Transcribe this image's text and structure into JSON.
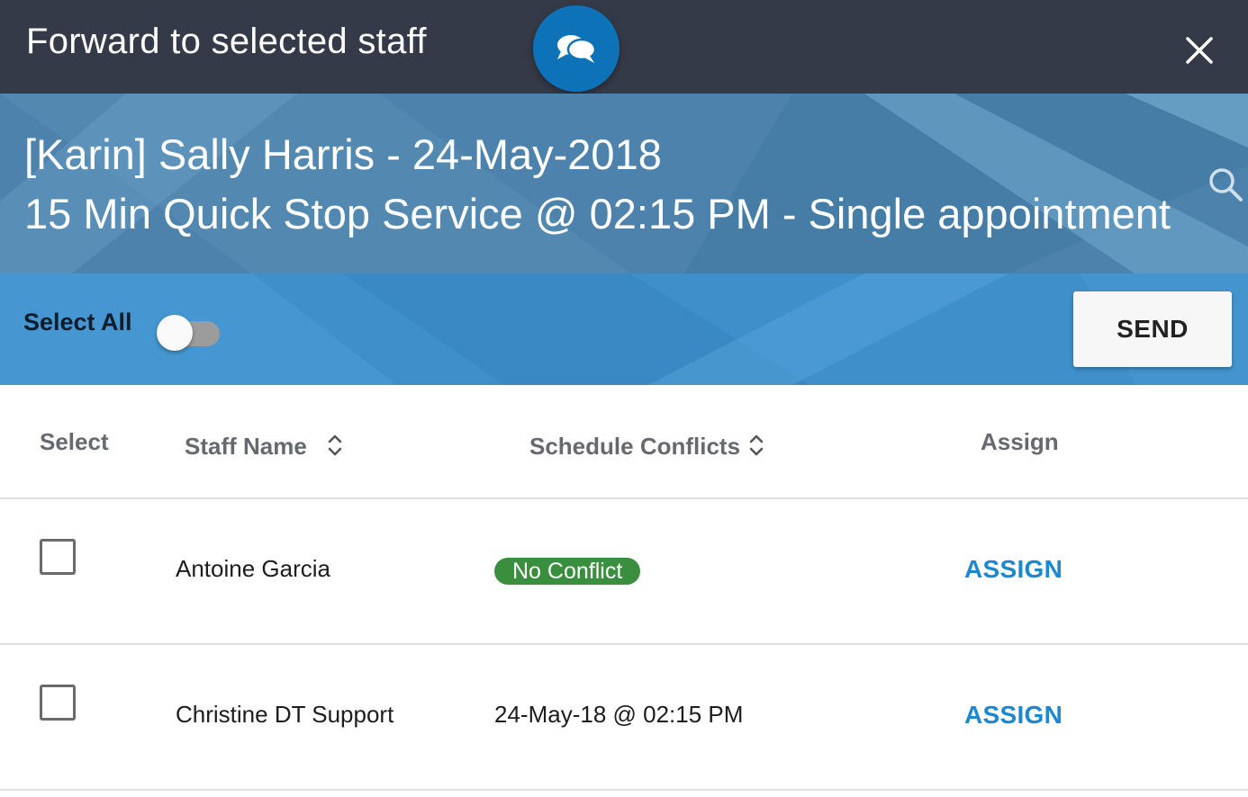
{
  "dialog": {
    "title": "Forward to selected staff",
    "chat_icon": "chat-bubbles-icon",
    "close_icon": "close-icon"
  },
  "appointment": {
    "line1": "[Karin] Sally Harris - 24-May-2018",
    "line2": "15 Min Quick Stop Service @ 02:15 PM - Single appointment",
    "search_icon": "search-icon"
  },
  "actions": {
    "select_all_label": "Select All",
    "select_all_on": false,
    "send_label": "SEND"
  },
  "table": {
    "headers": {
      "select": "Select",
      "staff_name": "Staff Name",
      "schedule_conflicts": "Schedule Conflicts",
      "assign": "Assign"
    },
    "rows": [
      {
        "checked": false,
        "staff_name": "Antoine Garcia",
        "conflict": "No Conflict",
        "conflict_is_badge": true,
        "assign_label": "ASSIGN"
      },
      {
        "checked": false,
        "staff_name": "Christine DT Support",
        "conflict": "24-May-18 @ 02:15 PM",
        "conflict_is_badge": false,
        "assign_label": "ASSIGN"
      }
    ]
  },
  "colors": {
    "topbar": "#353a48",
    "chat_badge": "#0d72b8",
    "banner": "#4c82ab",
    "actionbar": "#3f8fcb",
    "no_conflict_badge": "#3a8f3e",
    "assign_link": "#1b88cf"
  }
}
